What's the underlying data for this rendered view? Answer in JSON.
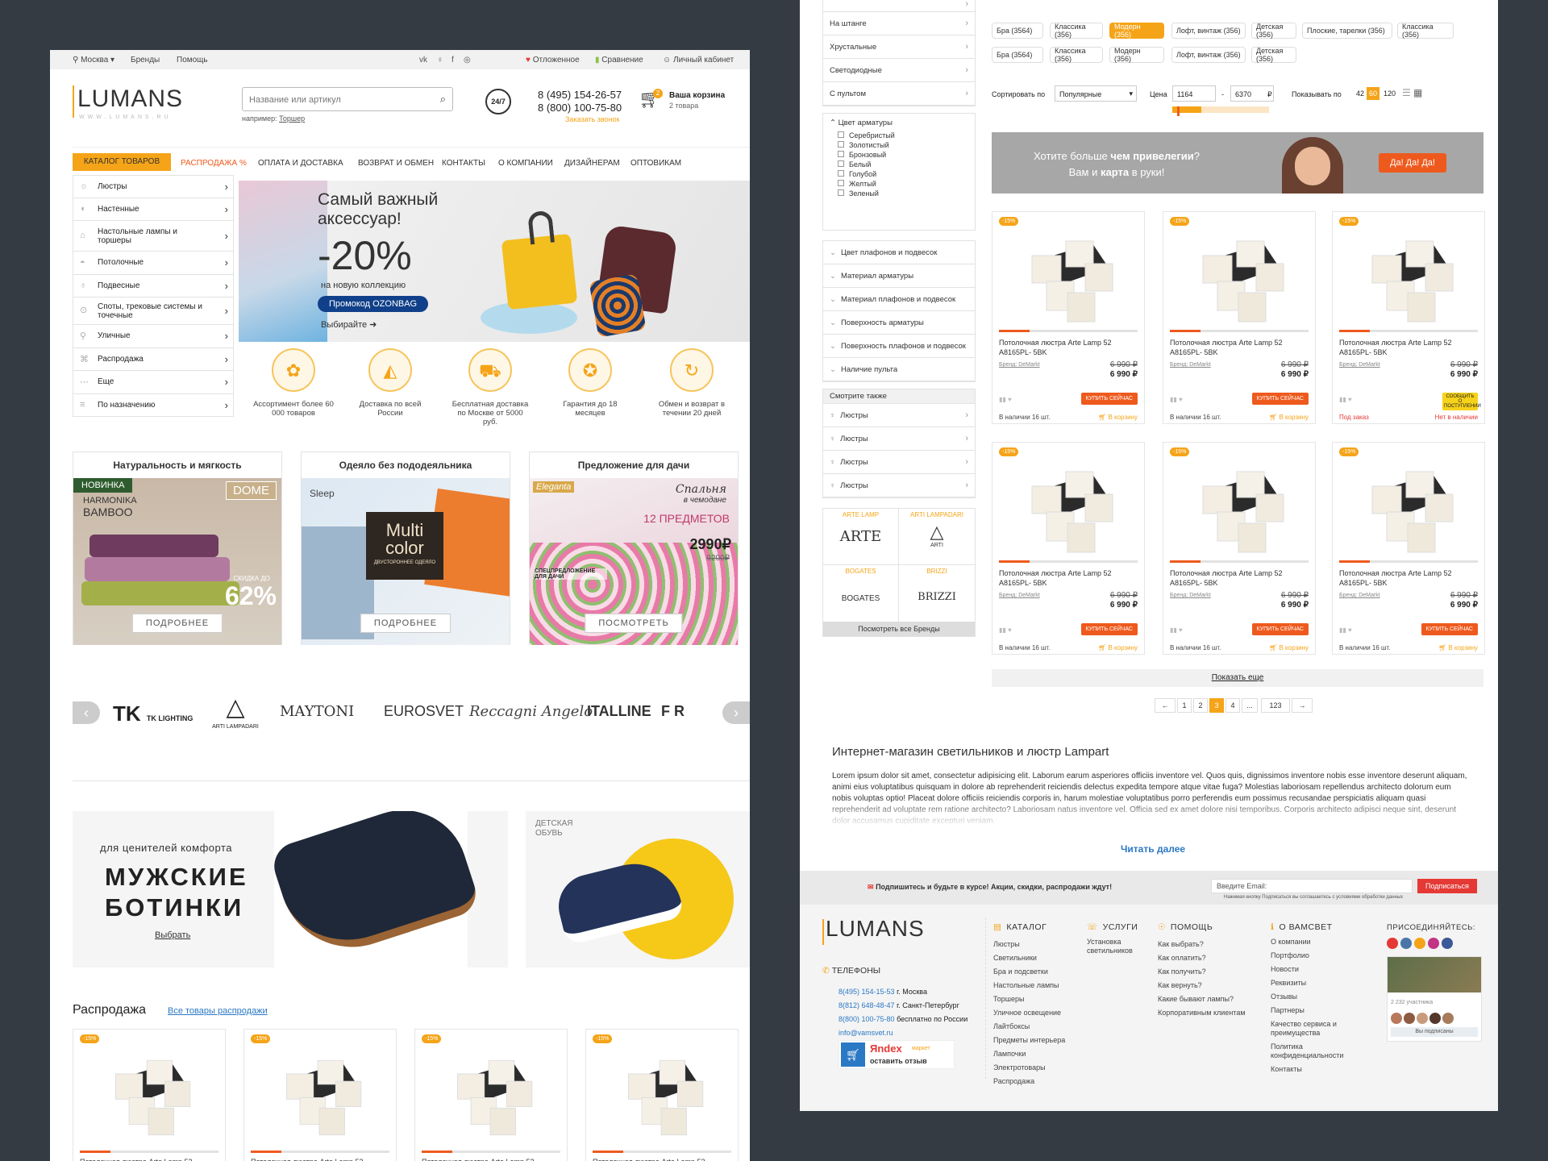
{
  "p1": {
    "topbar": {
      "city": "Москва",
      "brands": "Бренды",
      "help": "Помощь",
      "deferred": "Отложенное",
      "compare": "Сравнение",
      "account": "Личный кабинет"
    },
    "logo": "LUMANS",
    "logo_sub": "WWW.LUMANS.RU",
    "search": {
      "placeholder": "Название или артикул",
      "hint_label": "например:",
      "hint_value": "Торшер"
    },
    "h247": "24/7",
    "phone1": "8 (495) 154-26-57",
    "phone2": "8 (800) 100-75-80",
    "callback": "Заказать звонок",
    "cart": {
      "count": "2",
      "title": "Ваша корзина",
      "sub": "2 товара"
    },
    "nav": [
      "КАТАЛОГ ТОВАРОВ",
      "РАСПРОДАЖА %",
      "ОПЛАТА И ДОСТАВКА",
      "ВОЗВРАТ И ОБМЕН",
      "КОНТАКТЫ",
      "О КОМПАНИИ",
      "ДИЗАЙНЕРАМ",
      "ОПТОВИКАМ"
    ],
    "categories": [
      "Люстры",
      "Настенные",
      "Настольные лампы и торшеры",
      "Потолочные",
      "Подвесные",
      "Споты, трековые системы и точечные",
      "Уличные",
      "Распродажа",
      "Еще",
      "По назначению"
    ],
    "banner": {
      "title1": "Самый важный",
      "title2": "аксессуар!",
      "discount": "-20%",
      "sub": "на новую коллекцию",
      "promo": "Промокод OZONBAG",
      "cta": "Выбирайте"
    },
    "features": [
      "Ассортимент более 60 000 товаров",
      "Доставка по всей России",
      "Бесплатная доставка по Москве от 5000 руб.",
      "Гарантия до 18 месяцев",
      "Обмен и возврат в течении 20 дней"
    ],
    "promos": [
      {
        "title": "Натуральность и мягкость",
        "btn": "ПОДРОБНЕЕ",
        "new": "НОВИНКА",
        "brand": "DOME",
        "line1": "HARMONIKA",
        "line2": "BAMBOO",
        "sale_label": "СКИДКА ДО",
        "sale": "62%"
      },
      {
        "title": "Одеяло без пододеяльника",
        "btn": "ПОДРОБНЕЕ",
        "brand": "Sleep",
        "box1": "Multi",
        "box2": "color",
        "box3": "ДВУСТОРОННЕЕ ОДЕЯЛО"
      },
      {
        "title": "Предложение для дачи",
        "btn": "ПОСМОТРЕТЬ",
        "brand": "Eleganta",
        "line1": "Спальня",
        "line2": "в чемодане",
        "count": "12 ПРЕДМЕТОВ",
        "price": "2990₽",
        "old": "9200₽",
        "offer": "СПЕЦПРЕДЛОЖЕНИЕ ДЛЯ ДАЧИ"
      }
    ],
    "brands": [
      "TK LIGHTING",
      "ARTI LAMPADARI",
      "MAYTONI",
      "EUROSVET",
      "Reccagni Angelo",
      "ITALLINE",
      "F R"
    ],
    "banner_boots": {
      "sub": "для ценителей комфорта",
      "l1": "МУЖСКИЕ",
      "l2": "БОТИНКИ",
      "cta": "Выбрать"
    },
    "banner_kids": {
      "l1": "ДЕТСКАЯ",
      "l2": "ОБУВЬ"
    },
    "sale": {
      "title": "Распродажа",
      "link": "Все товары распродажи",
      "badge": "-15%",
      "name": "Потолочная люстра Arte Lamp 52"
    }
  },
  "p2": {
    "left_top": [
      "На штанге",
      "Хрустальные",
      "Светодиодные",
      "С пультом"
    ],
    "armature_color": {
      "title": "Цвет арматуры",
      "options": [
        "Серебристый",
        "Золотистый",
        "Бронзовый",
        "Белый",
        "Голубой",
        "Желтый",
        "Зеленый"
      ]
    },
    "filters": [
      "Цвет плафонов и подвесок",
      "Материал арматуры",
      "Материал плафонов и подвесок",
      "Поверхность арматуры",
      "Поверхность плафонов и подвесок",
      "Наличие пульта"
    ],
    "see_also": {
      "title": "Смотрите также",
      "items": [
        "Люстры",
        "Люстры",
        "Люстры",
        "Люстры"
      ]
    },
    "brandgrid": [
      {
        "n": "ARTE LAMP",
        "l": "ARTE"
      },
      {
        "n": "ARTI LAMPADARI",
        "l": "ARTI"
      },
      {
        "n": "BOGATES",
        "l": "BOGATES"
      },
      {
        "n": "BRIZZI",
        "l": "BRIZZI"
      }
    ],
    "all_brands": "Посмотреть все Бренды",
    "tags1": [
      "Бра (3564)",
      "Классика (356)",
      "Модерн (356)",
      "Лофт, винтаж (356)",
      "Детская (356)",
      "Плоские, тарелки (356)",
      "Классика (356)"
    ],
    "tags2": [
      "Бра (3564)",
      "Классика (356)",
      "Модерн (356)",
      "Лофт, винтаж (356)",
      "Детская (356)"
    ],
    "sort": {
      "label": "Сортировать по",
      "value": "Популярные",
      "price": "Цена",
      "from": "1164",
      "to": "6370",
      "cur": "₽",
      "show": "Показывать по",
      "n1": "42",
      "n2": "60",
      "n3": "120"
    },
    "priv": {
      "l1a": "Хотите больше ",
      "l1b": "чем привелегии",
      "l1c": "?",
      "l2a": "Вам и ",
      "l2b": "карта",
      "l2c": " в руки!",
      "btn": "Да! Да! Да!"
    },
    "product": {
      "badge": "-15%",
      "name1": "Потолочная люстра Arte Lamp 52",
      "name2": "A8165PL- 5BK",
      "brand": "Бренд: DeMarkt",
      "old": "6 990 ₽",
      "new": "6 990 ₽",
      "buy": "КУПИТЬ СЕЙЧАС",
      "notify": "СООБЩИТЬ О ПОСТУПЛЕНИИ",
      "stock": "В наличии 16 шт.",
      "cart": "В корзину",
      "preorder": "Под заказ",
      "none": "Нет в наличии"
    },
    "more": "Показать еще",
    "pages": [
      "←",
      "1",
      "2",
      "3",
      "4",
      "...",
      "123",
      "→"
    ],
    "seo": {
      "title": "Интернет-магазин светильников и люстр Lampart",
      "text": "Lorem ipsum dolor sit amet, consectetur adipisicing elit. Laborum earum asperiores officiis inventore vel. Quos quis, dignissimos inventore nobis esse inventore deserunt aliquam, animi eius voluptatibus quisquam in dolore ab reprehenderit reiciendis delectus expedita tempore atque vitae fuga? Molestias laboriosam repellendus architecto dolorum eum nobis voluptas optio! Placeat dolore officiis reiciendis corporis in, harum molestiae voluptatibus porro perferendis eum possimus recusandae perspiciatis aliquam quasi reprehenderit ad voluptate rem ratione architecto? Laboriosam natus inventore vel. Officia sed ex amet dolore nisi temporibus. Corporis architecto adipisci neque sint, deserunt dolor accusamus cupiditate excepturi veniam.",
      "more": "Читать далее"
    },
    "subscribe": {
      "text": "Подпишитесь и будьте в курсе! Акции, скидки, распродажи ждут!",
      "placeholder": "Введите Email:",
      "btn": "Подписаться",
      "note": "Нажимая кнопку Подписаться вы соглашаетесь с условиями обработки данных"
    },
    "footer": {
      "logo": "LUMANS",
      "phones_title": "ТЕЛЕФОНЫ",
      "phones": [
        [
          "8(495) 154-15-53",
          "г. Москва"
        ],
        [
          "8(812) 648-48-47",
          "г. Санкт-Петербург"
        ],
        [
          "8(800) 100-75-80",
          "бесплатно по России"
        ]
      ],
      "email": "info@vamsvet.ru",
      "ym1": "Яndex",
      "ym2": "маркет",
      "ym3": "оставить отзыв",
      "catalog_title": "КАТАЛОГ",
      "catalog": [
        "Люстры",
        "Светильники",
        "Бра и подсветки",
        "Настольные лампы",
        "Торшеры",
        "Уличное освещение",
        "Лайтбоксы",
        "Предметы интерьера",
        "Лампочки",
        "Электротовары",
        "Распродажа"
      ],
      "services_title": "УСЛУГИ",
      "services": [
        "Установка светильников"
      ],
      "help_title": "ПОМОЩЬ",
      "help": [
        "Как выбрать?",
        "Как оплатить?",
        "Как получить?",
        "Как вернуть?",
        "Какие бывают лампы?",
        "Корпоративным клиентам"
      ],
      "about_title": "О ВАМСВЕТ",
      "about": [
        "О компании",
        "Портфолио",
        "Новости",
        "Реквизиты",
        "Отзывы",
        "Партнеры",
        "Качество сервиса и преимущества",
        "Политика конфиденциальности",
        "Контакты"
      ],
      "join": "ПРИСОЕДИНЯЙТЕСЬ:",
      "widget_members": "2 232 участника",
      "widget_btn": "Вы подписаны"
    }
  }
}
